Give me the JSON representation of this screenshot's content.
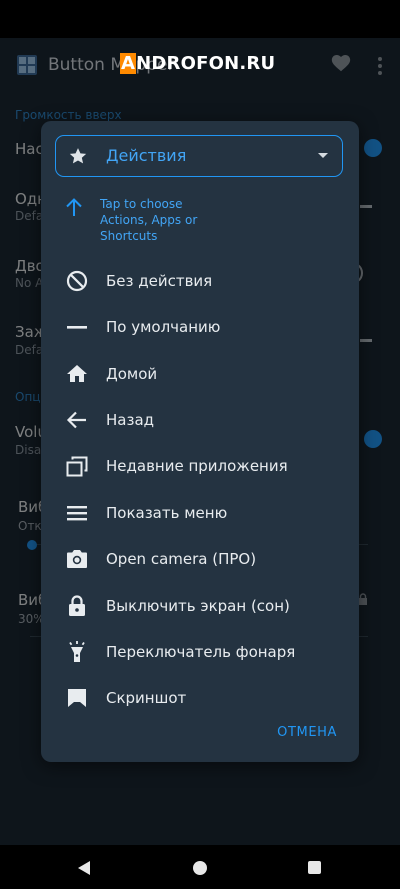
{
  "app": {
    "title": "Button Mapper",
    "icons": {
      "app": "app-logo-icon",
      "favorite": "heart-icon",
      "more": "more-vert-icon"
    }
  },
  "watermark": {
    "first": "A",
    "rest": "NDROFON.RU"
  },
  "background": {
    "section_volume_up": "Громкость вверх",
    "rows": [
      {
        "title": "Нас",
        "sub": ""
      },
      {
        "title": "Одн",
        "sub": "Defa"
      },
      {
        "title": "Дво",
        "sub": "No A"
      },
      {
        "title": "Заж",
        "sub": "Defa"
      }
    ],
    "section_options": "Опц",
    "volume_row": {
      "title": "Volu",
      "sub": "Disa"
    },
    "slider1": {
      "title": "Виб",
      "sub": "Отк"
    },
    "slider2": {
      "title": "Виб",
      "sub": "30%"
    }
  },
  "dialog": {
    "selected": "Действия",
    "selected_icon": "star-icon",
    "hint": "Tap to choose Actions, Apps or Shortcuts",
    "items": [
      {
        "label": "Без действия",
        "icon": "block-icon"
      },
      {
        "label": "По умолчанию",
        "icon": "minus-icon"
      },
      {
        "label": "Домой",
        "icon": "home-icon"
      },
      {
        "label": "Назад",
        "icon": "arrow-back-icon"
      },
      {
        "label": "Недавние приложения",
        "icon": "recent-apps-icon"
      },
      {
        "label": "Показать меню",
        "icon": "menu-icon"
      },
      {
        "label": "Open camera (ПРО)",
        "icon": "camera-icon"
      },
      {
        "label": "Выключить экран (сон)",
        "icon": "lock-icon"
      },
      {
        "label": "Переключатель фонаря",
        "icon": "flashlight-icon"
      },
      {
        "label": "Скриншот",
        "icon": "screenshot-icon"
      }
    ],
    "cancel": "ОТМЕНА"
  },
  "colors": {
    "accent": "#2196f3",
    "dialog_bg": "#243341",
    "app_bg": "#1b2732"
  }
}
